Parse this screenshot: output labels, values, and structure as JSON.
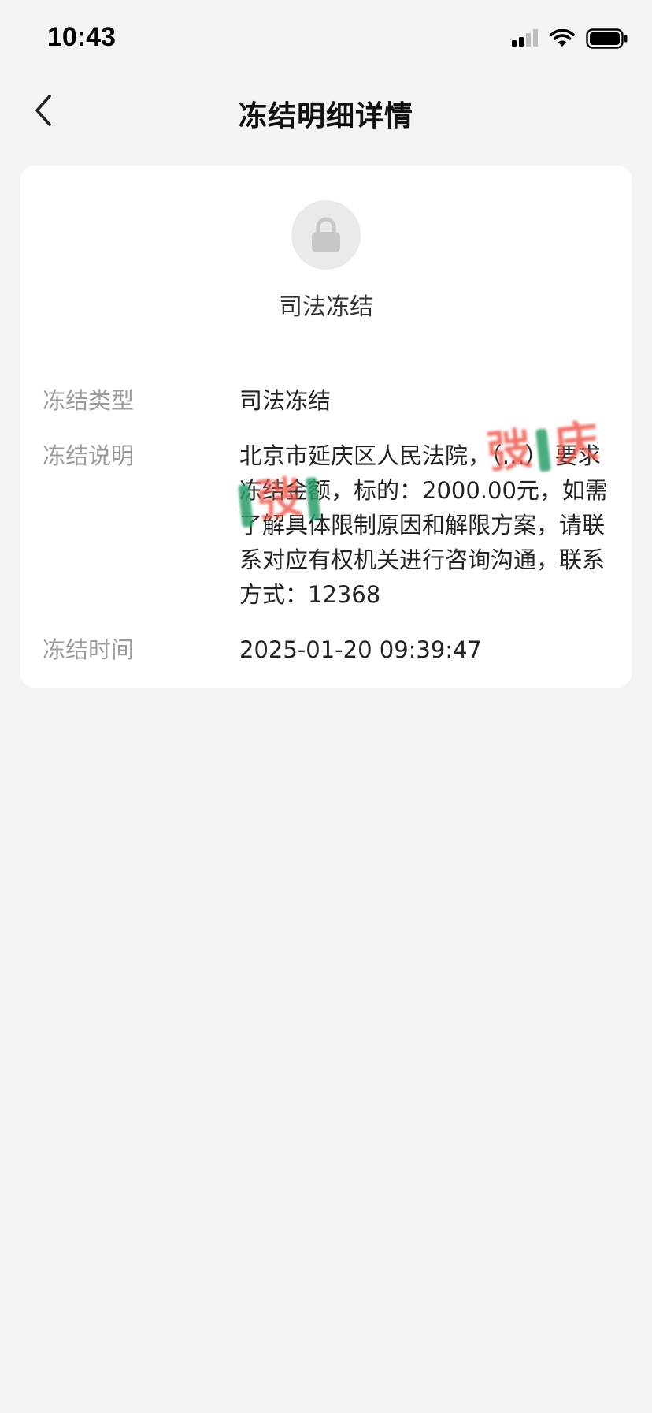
{
  "status_bar": {
    "time": "10:43"
  },
  "nav": {
    "title": "冻结明细详情"
  },
  "card": {
    "heading": "司法冻结",
    "rows": [
      {
        "label": "冻结类型",
        "value": "司法冻结"
      },
      {
        "label": "冻结说明",
        "value": "北京市延庆区人民法院，（…） 要求冻结金额，标的：2000.00元，如需了解具体限制原因和解限方案，请联系对应有权机关进行咨询沟通，联系方式：12368"
      },
      {
        "label": "冻结时间",
        "value": "2025-01-20 09:39:47"
      }
    ]
  },
  "watermark": {
    "text_1": "弢",
    "text_2": "庆",
    "text_3": "弢"
  },
  "colors": {
    "background": "#f4f4f4",
    "card": "#ffffff",
    "label": "#9b9b9b",
    "value": "#222222",
    "lock_circle": "#eaeaea",
    "watermark_red": "#ee5a4f",
    "watermark_green": "#2a9e6b"
  },
  "icons": {
    "back": "chevron-left-icon",
    "lock": "lock-icon",
    "signal": "signal-icon",
    "wifi": "wifi-icon",
    "battery": "battery-icon"
  }
}
